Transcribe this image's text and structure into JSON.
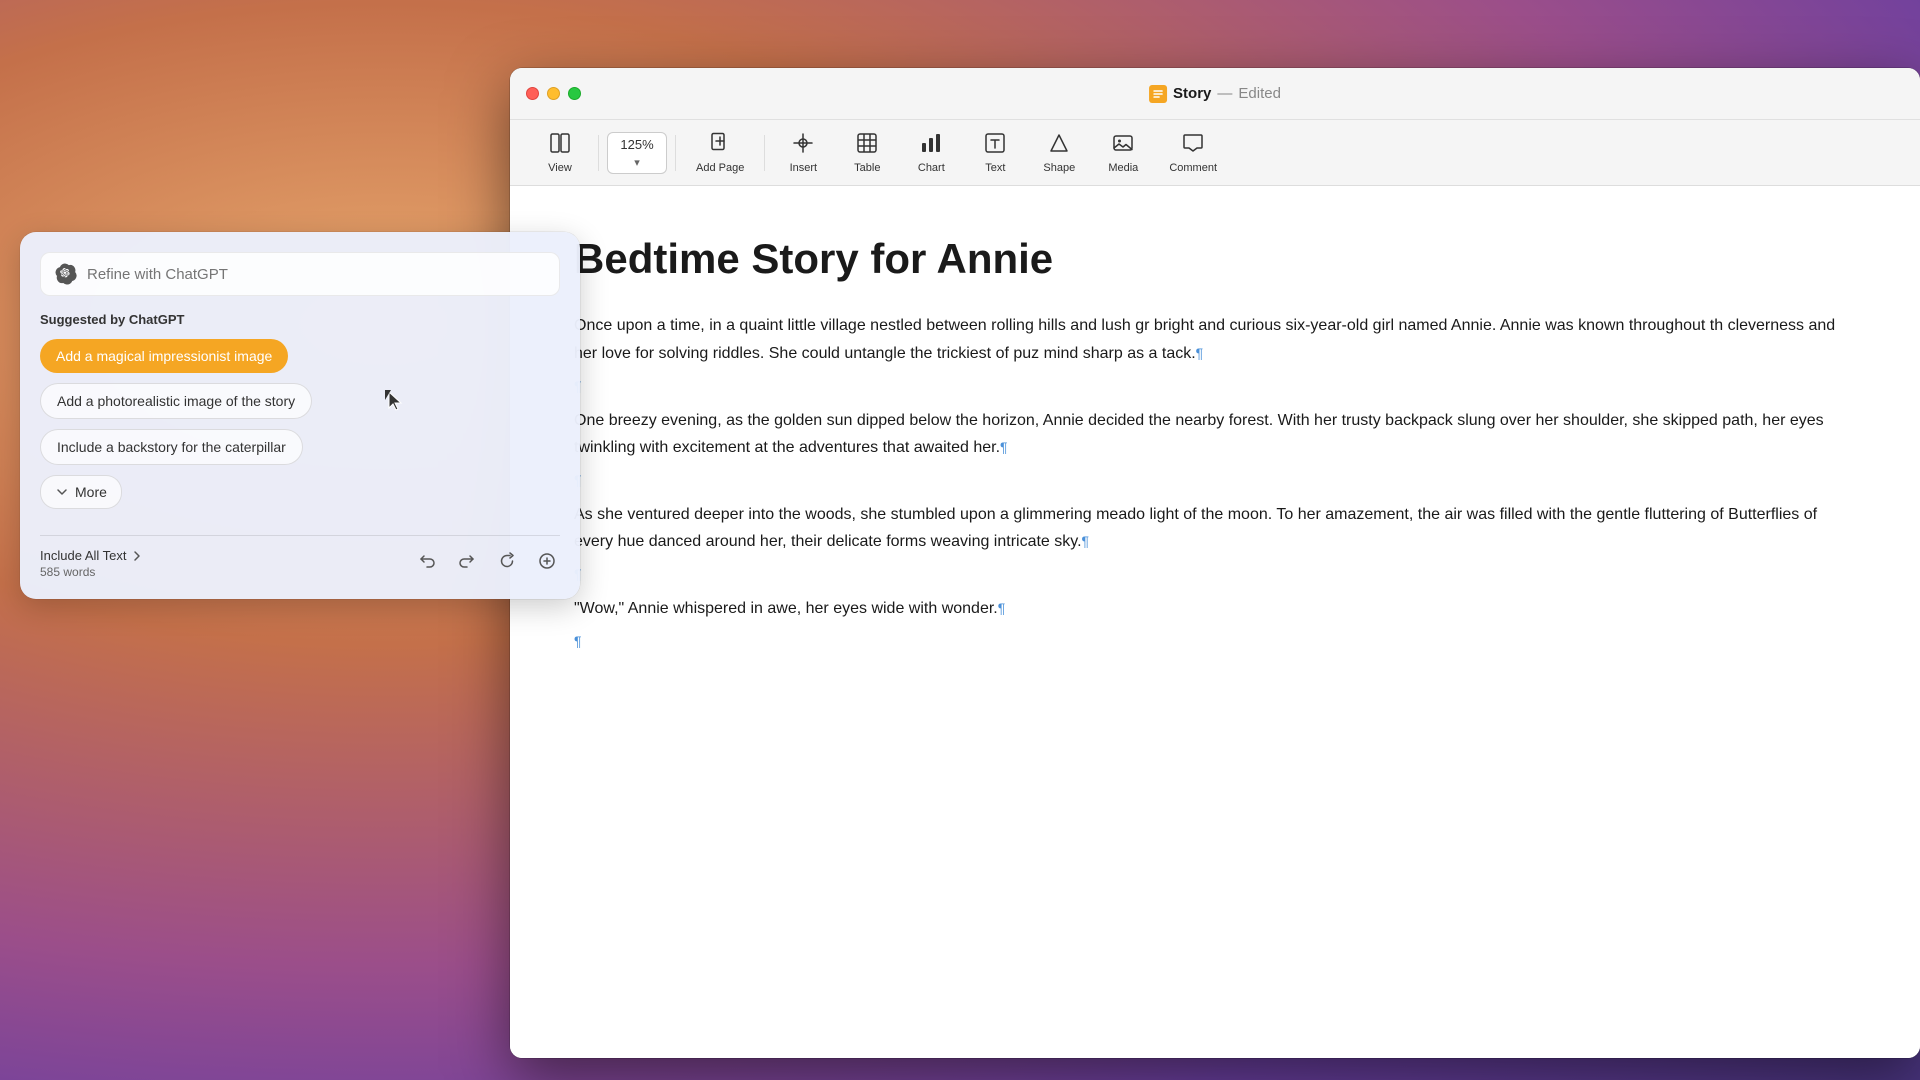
{
  "desktop": {
    "background": "macOS Monterey wallpaper"
  },
  "window": {
    "title": "Story",
    "separator": "—",
    "status": "Edited",
    "icon_color": "#f5a623"
  },
  "traffic_lights": {
    "close_label": "close",
    "minimize_label": "minimize",
    "maximize_label": "maximize"
  },
  "toolbar": {
    "zoom_value": "125%",
    "zoom_chevron": "▾",
    "items": [
      {
        "id": "view",
        "icon": "⊡",
        "label": "View"
      },
      {
        "id": "zoom",
        "label": "125%",
        "special": "zoom"
      },
      {
        "id": "add-page",
        "icon": "⊕",
        "label": "Add Page"
      },
      {
        "id": "insert",
        "icon": "≡",
        "label": "Insert"
      },
      {
        "id": "table",
        "icon": "⊞",
        "label": "Table"
      },
      {
        "id": "chart",
        "icon": "⊙",
        "label": "Chart"
      },
      {
        "id": "text",
        "icon": "T",
        "label": "Text"
      },
      {
        "id": "shape",
        "icon": "△",
        "label": "Shape"
      },
      {
        "id": "media",
        "icon": "▨",
        "label": "Media"
      },
      {
        "id": "comment",
        "icon": "💬",
        "label": "Comment"
      }
    ]
  },
  "document": {
    "title": "Bedtime Story for Annie",
    "paragraphs": [
      {
        "id": "p1",
        "text": "Once upon a time, in a quaint little village nestled between rolling hills and lush gr bright and curious six-year-old girl named Annie. Annie was known throughout th cleverness and her love for solving riddles. She could untangle the trickiest of puz mind sharp as a tack.",
        "has_mark": true
      },
      {
        "id": "p2",
        "text": "",
        "empty": true
      },
      {
        "id": "p3",
        "text": "One breezy evening, as the golden sun dipped below the horizon, Annie decided the nearby forest. With her trusty backpack slung over her shoulder, she skipped path, her eyes twinkling with excitement at the adventures that awaited her.",
        "has_mark": true
      },
      {
        "id": "p4",
        "text": "",
        "empty": true
      },
      {
        "id": "p5",
        "text": "As she ventured deeper into the woods, she stumbled upon a glimmering meado light of the moon. To her amazement, the air was filled with the gentle fluttering of Butterflies of every hue danced around her, their delicate forms weaving intricate sky.",
        "has_mark": true
      },
      {
        "id": "p6",
        "text": "",
        "empty": true
      },
      {
        "id": "p7",
        "text": "\"Wow,\" Annie whispered in awe, her eyes wide with wonder.",
        "has_mark": true
      },
      {
        "id": "p8",
        "text": "",
        "empty": true
      }
    ]
  },
  "chatgpt_panel": {
    "input_placeholder": "Refine with ChatGPT",
    "suggested_label": "Suggested by ChatGPT",
    "suggestions": [
      {
        "id": "suggestion-1",
        "text": "Add a magical impressionist image",
        "active": true
      },
      {
        "id": "suggestion-2",
        "text": "Add a photorealistic image of the story",
        "active": false
      },
      {
        "id": "suggestion-3",
        "text": "Include a backstory for the caterpillar",
        "active": false
      }
    ],
    "more_label": "More",
    "more_chevron": "›",
    "include_all_text_label": "Include All Text",
    "word_count": "585 words",
    "actions": {
      "undo": "↩",
      "redo": "↪",
      "refresh": "↻",
      "add": "⊕"
    }
  }
}
